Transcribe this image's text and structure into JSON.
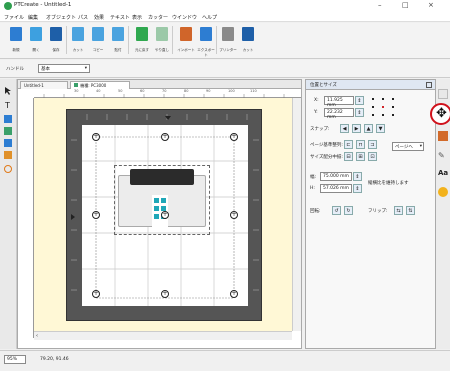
{
  "window": {
    "title": "PTCreate - Untitled-1",
    "min": "–",
    "max": "□",
    "close": "×"
  },
  "menu": [
    "ファイル",
    "編集",
    "オブジェクト",
    "パス",
    "効果",
    "テキスト",
    "表示",
    "カッター",
    "ウインドウ",
    "ヘルプ"
  ],
  "toolbar": {
    "labels": [
      "新規",
      "開く",
      "保存",
      "カット",
      "コピー",
      "貼付",
      "元に戻す",
      "やり直し",
      "インポート",
      "エクスポート",
      "プリンター",
      "カット"
    ]
  },
  "handle": {
    "label": "ハンドル",
    "value": "基本"
  },
  "tabs": [
    "Untitled-1",
    "機種: PC3000"
  ],
  "panel": {
    "title": "位置とサイズ",
    "x_label": "X:",
    "x_value": "11.925 mm",
    "y_label": "Y:",
    "y_value": "22.232 mm",
    "snap_label": "スナップ:",
    "align_label": "ページ基準整列:",
    "align_select": "ページへ",
    "distribute_label": "サイズ配分中揃:",
    "w_label": "幅:",
    "w_value": "75.000 mm",
    "h_label": "H:",
    "h_value": "57.026 mm",
    "ratio_label": "縦横比を維持します",
    "rotate_label": "回転:",
    "flip_label": "フリップ:"
  },
  "status": {
    "zoom": "95%",
    "coords": "79.20, 91.46"
  },
  "ruler_ticks": [
    "30",
    "40",
    "50",
    "60",
    "70",
    "80",
    "90",
    "100",
    "110"
  ]
}
